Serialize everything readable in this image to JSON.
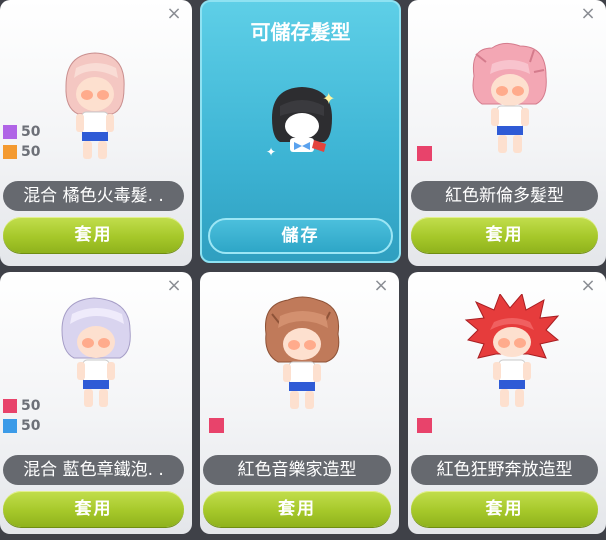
{
  "close_glyph": "×",
  "save_card": {
    "title": "可儲存髮型",
    "button_label": "儲存"
  },
  "cards": [
    {
      "name": "混合  橘色火毒髮. .",
      "button_label": "套用",
      "hair_color": "#f4c7c2",
      "swatches": [
        {
          "color": "#b064e6",
          "value": "50"
        },
        {
          "color": "#f49a30",
          "value": "50"
        }
      ]
    },
    {
      "name": "紅色新倫多髮型",
      "button_label": "套用",
      "hair_color": "#f3a7b4",
      "swatch_color": "#e8436b"
    },
    {
      "name": "混合  藍色章鐵泡. .",
      "button_label": "套用",
      "hair_color": "#d9d4ef",
      "swatches": [
        {
          "color": "#e8436b",
          "value": "50"
        },
        {
          "color": "#3c9be8",
          "value": "50"
        }
      ]
    },
    {
      "name": "紅色音樂家造型",
      "button_label": "套用",
      "hair_color": "#c07a5a",
      "swatch_color": "#e8436b"
    },
    {
      "name": "紅色狂野奔放造型",
      "button_label": "套用",
      "hair_color": "#e63c3c",
      "swatch_color": "#e8436b"
    }
  ]
}
